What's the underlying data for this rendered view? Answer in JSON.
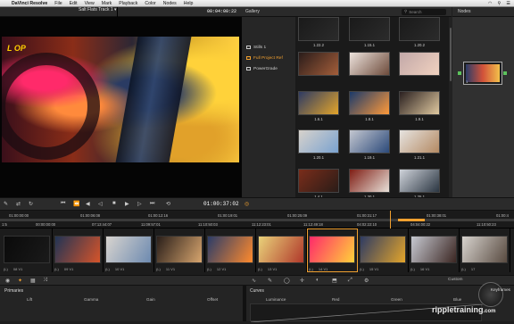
{
  "menubar": {
    "app_name": "DaVinci Resolve",
    "items": [
      "File",
      "Edit",
      "View",
      "Mark",
      "Playback",
      "Color",
      "Nodes",
      "Help"
    ]
  },
  "viewer": {
    "clip_name": "Salt Flats Track 1 ▾",
    "timecode": "00:04:00:22",
    "plate_text": "L OP"
  },
  "gallery": {
    "title": "Gallery",
    "search_placeholder": "Search",
    "albums": [
      {
        "label": "Stills 1",
        "selected": false
      },
      {
        "label": "Full Project Ref",
        "selected": true
      },
      {
        "label": "PowerGrade",
        "selected": false
      }
    ],
    "stills": [
      {
        "label": "1.22.2",
        "colors": [
          "#1a1a1a",
          "#2b2b2b"
        ]
      },
      {
        "label": "1.15.1",
        "colors": [
          "#1a1a1a",
          "#2b2b2b"
        ]
      },
      {
        "label": "1.20.2",
        "colors": [
          "#1a1a1a",
          "#2b2b2b"
        ]
      },
      {
        "label": "",
        "colors": [
          "#2a1c1a",
          "#a45e3a"
        ]
      },
      {
        "label": "",
        "colors": [
          "#ede3dd",
          "#6d4b3b"
        ]
      },
      {
        "label": "",
        "colors": [
          "#c2a8a8",
          "#f1d2c0"
        ]
      },
      {
        "label": "1.6.1",
        "colors": [
          "#2e3b63",
          "#e3a52b"
        ]
      },
      {
        "label": "1.8.1",
        "colors": [
          "#1b3a6a",
          "#ff9a3a"
        ]
      },
      {
        "label": "1.9.1",
        "colors": [
          "#2a2020",
          "#e0c9a0"
        ]
      },
      {
        "label": "1.20.1",
        "colors": [
          "#d7d2cc",
          "#7aa2cf"
        ]
      },
      {
        "label": "1.19.1",
        "colors": [
          "#c4c7d0",
          "#2c4a7a"
        ]
      },
      {
        "label": "1.21.1",
        "colors": [
          "#e6e3e0",
          "#b48a63"
        ]
      },
      {
        "label": "1.4.1",
        "colors": [
          "#7a2d1a",
          "#2a1c18"
        ]
      },
      {
        "label": "1.30.1",
        "colors": [
          "#7f1d14",
          "#e8e0d8"
        ]
      },
      {
        "label": "1.25.1",
        "colors": [
          "#cfd3da",
          "#2b3642"
        ]
      },
      {
        "label": "",
        "colors": [
          "#d4b08c",
          "#4a2a1a"
        ]
      },
      {
        "label": "",
        "colors": [
          "#ede6df",
          "#3a3032"
        ]
      },
      {
        "label": "",
        "colors": [
          "#dcd6cf",
          "#50483f"
        ]
      }
    ]
  },
  "nodes": {
    "title": "Nodes",
    "node_label": "1"
  },
  "transport": {
    "timecode": "01:00:37:02"
  },
  "ruler": {
    "top_labels": [
      "01:00:00:00",
      "01:00:06:08",
      "01:00:12:16",
      "01:00:19:01",
      "01:00:25:09",
      "01:00:31:17",
      "01:00:38:01",
      "01:00:4"
    ],
    "clip_tcs": [
      "00:00:00:00",
      "07:13:44:07",
      "11:09:57:01",
      "11:10:50:03",
      "11:12:23:01",
      "11:12:49:18",
      "04:02:22:10",
      "04:04:00:22",
      "11:10:50:23"
    ]
  },
  "clips": [
    {
      "index": "",
      "track": "(L)",
      "name": "08 V1",
      "colors": [
        "#0a0a0a",
        "#1a1a1a"
      ]
    },
    {
      "index": "",
      "track": "(L)",
      "name": "09 V1",
      "colors": [
        "#213455",
        "#d6542a"
      ]
    },
    {
      "index": "",
      "track": "(L)",
      "name": "10 V1",
      "colors": [
        "#d8d4cf",
        "#6d8ab0"
      ]
    },
    {
      "index": "",
      "track": "(L)",
      "name": "11 V1",
      "colors": [
        "#2a1f1a",
        "#d7a56e"
      ]
    },
    {
      "index": "",
      "track": "(L)",
      "name": "12 V1",
      "colors": [
        "#2b3c68",
        "#ff8a2d"
      ]
    },
    {
      "index": "",
      "track": "(L)",
      "name": "13 V1",
      "colors": [
        "#e9d27a",
        "#b0382a"
      ]
    },
    {
      "index": "",
      "track": "(L)",
      "name": "14 V1",
      "colors": [
        "#ff2a6a",
        "#ffd23a"
      ]
    },
    {
      "index": "",
      "track": "(L)",
      "name": "15 V1",
      "colors": [
        "#2e3b63",
        "#e3a52b"
      ]
    },
    {
      "index": "",
      "track": "(L)",
      "name": "16 V1",
      "colors": [
        "#c6c9d1",
        "#3b2622"
      ]
    },
    {
      "index": "",
      "track": "(L)",
      "name": "17",
      "colors": [
        "#d7d3ce",
        "#584a40"
      ]
    }
  ],
  "toolbar": {
    "custom": "Custom"
  },
  "primaries": {
    "title": "Primaries",
    "wheels": [
      "Lift",
      "Gamma",
      "Gain",
      "Offset"
    ]
  },
  "curves": {
    "title": "Curves",
    "channels": [
      "Luminance",
      "Red",
      "Green",
      "Blue"
    ]
  },
  "watermark": {
    "brand": "rippletraining",
    "domain": ".com",
    "keyframes": "Keyframes"
  },
  "timeline_marker": "1:5"
}
